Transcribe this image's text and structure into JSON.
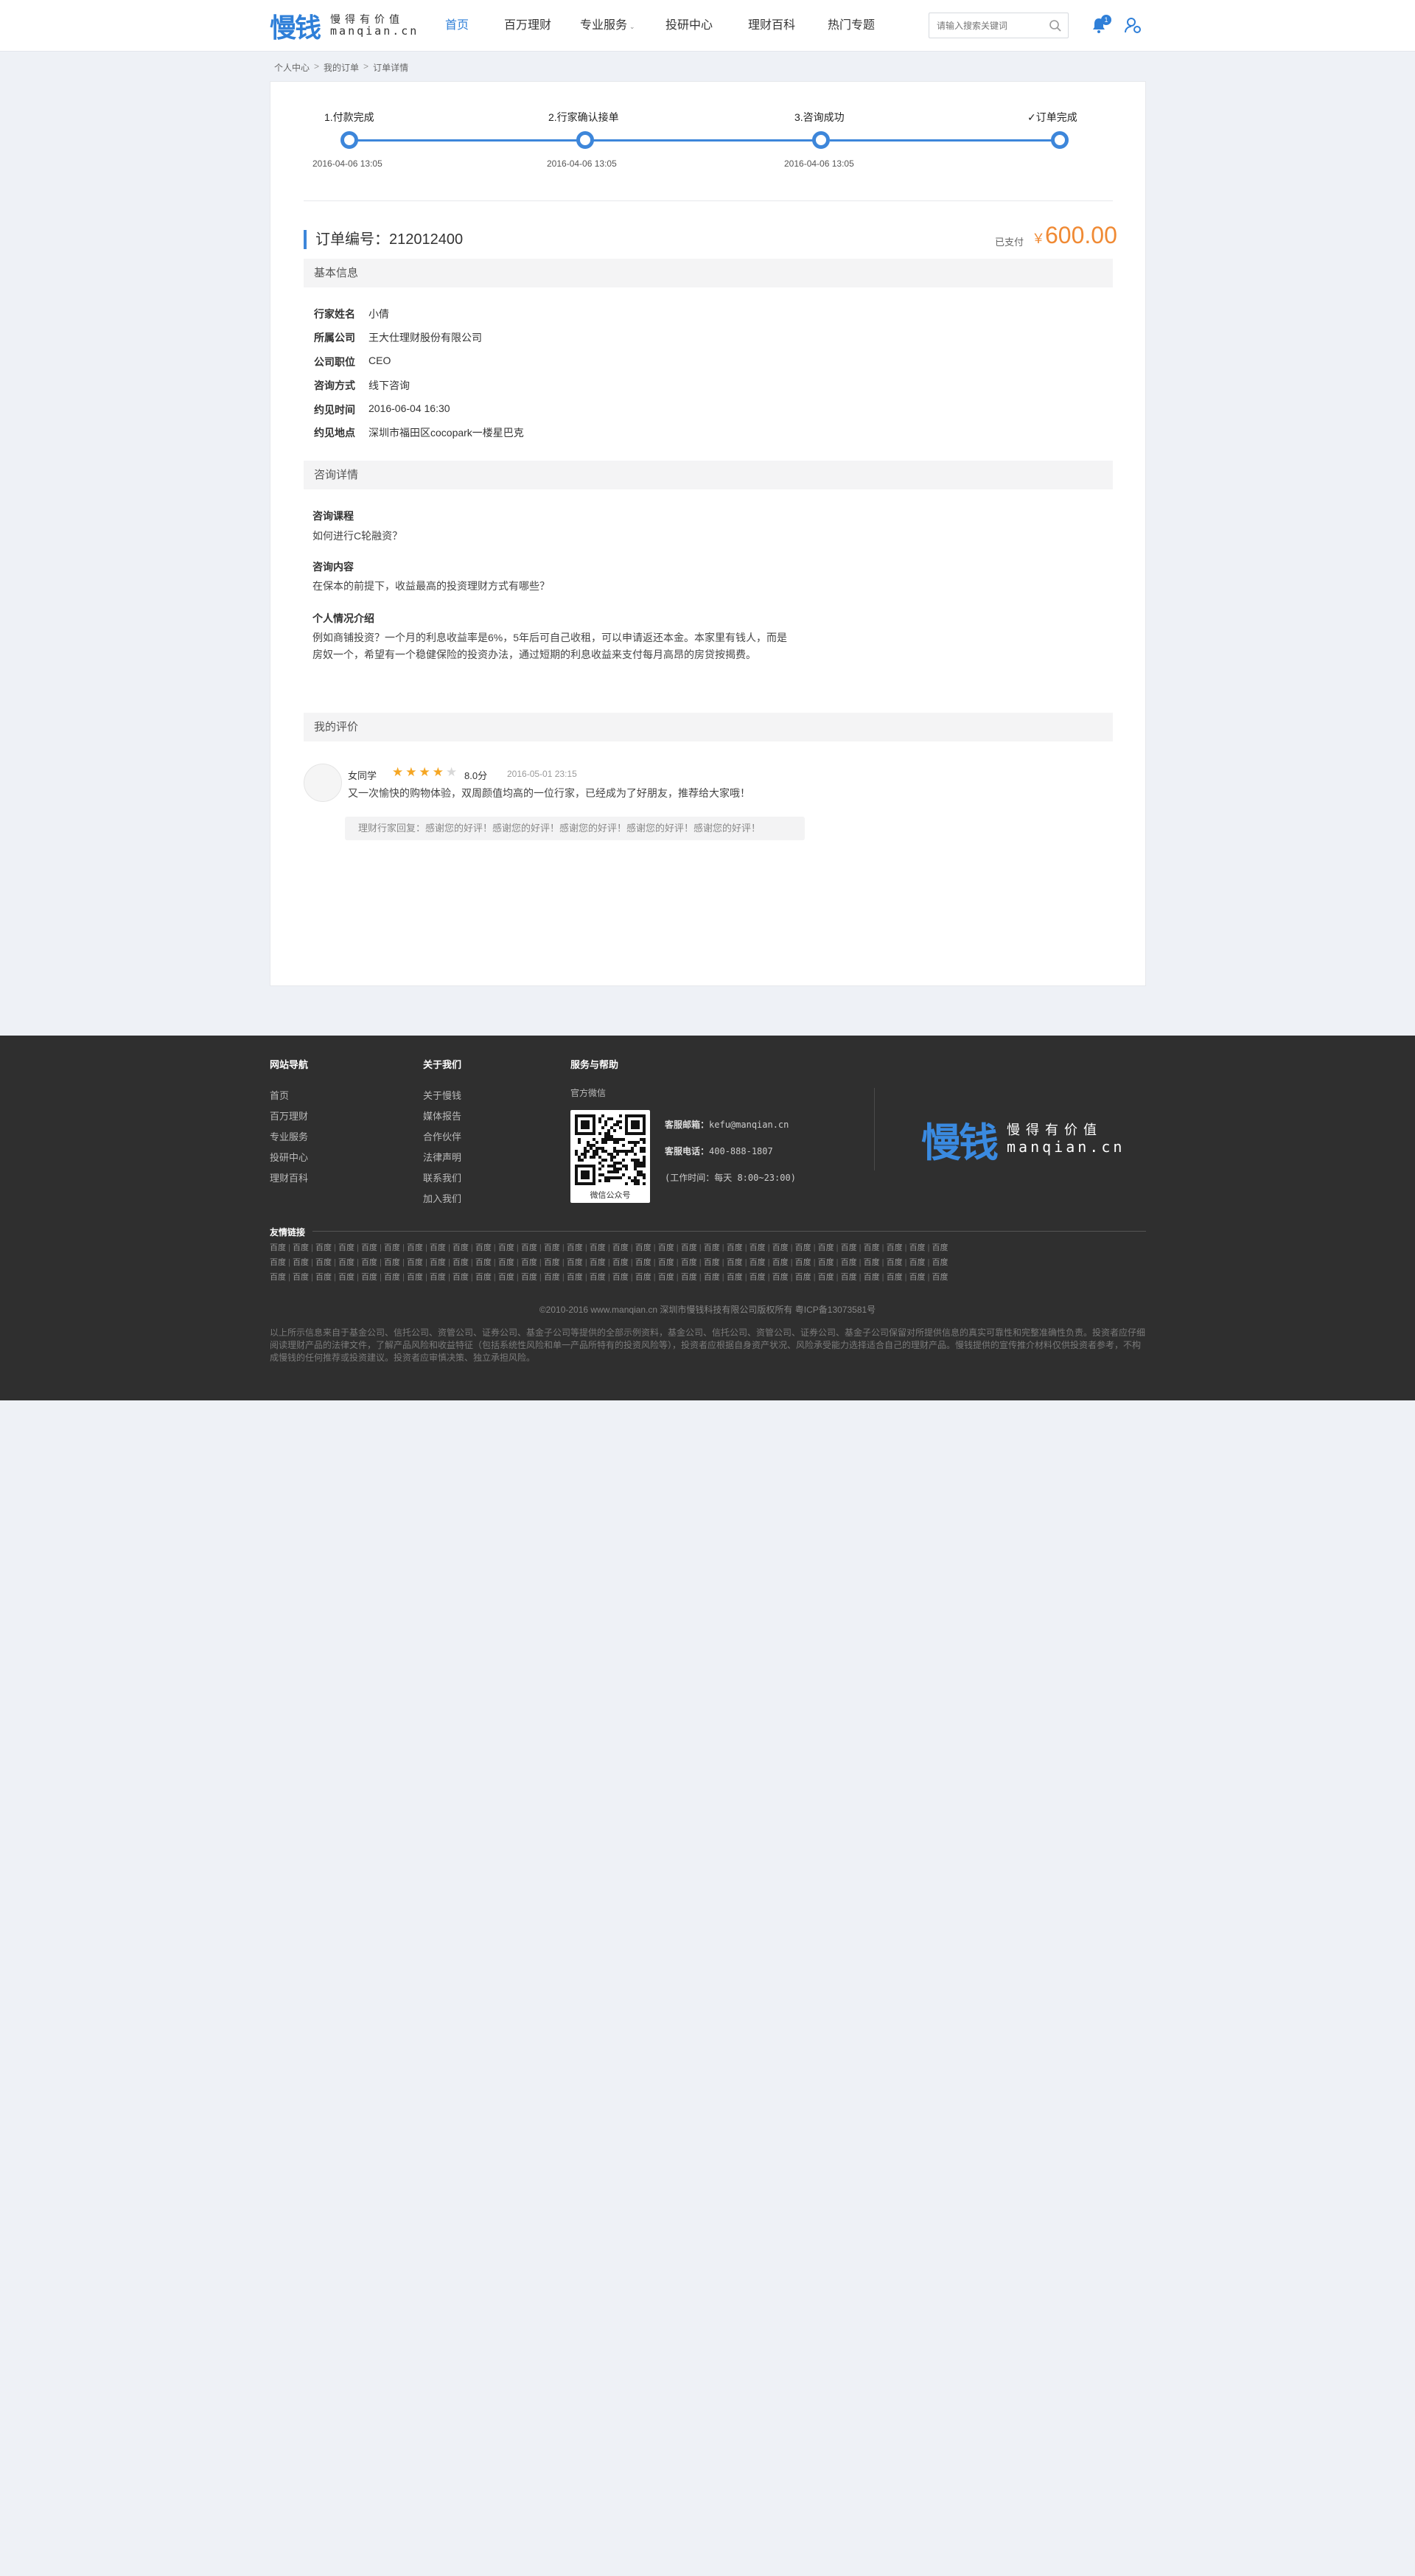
{
  "header": {
    "logo_cn": "慢钱",
    "logo_slogan": "慢得有价值",
    "logo_domain": "manqian.cn",
    "nav": [
      {
        "label": "首页",
        "active": true
      },
      {
        "label": "百万理财"
      },
      {
        "label": "专业服务",
        "has_dropdown": true,
        "dropdown_icon": "chevron-down-icon"
      },
      {
        "label": "投研中心"
      },
      {
        "label": "理财百科"
      },
      {
        "label": "热门专题"
      }
    ],
    "search_placeholder": "请输入搜索关键词",
    "notification_count": "1"
  },
  "breadcrumb": [
    "个人中心",
    "我的订单",
    "订单详情"
  ],
  "progress": {
    "steps": [
      {
        "label": "1.付款完成",
        "time": "2016-04-06 13:05"
      },
      {
        "label": "2.行家确认接单",
        "time": "2016-04-06 13:05"
      },
      {
        "label": "3.咨询成功",
        "time": "2016-04-06 13:05"
      },
      {
        "label": "订单完成",
        "time": ""
      }
    ]
  },
  "order": {
    "number_label": "订单编号：",
    "number": "212012400",
    "status": "已支付",
    "currency": "￥",
    "amount": "600.00"
  },
  "basic_info": {
    "title": "基本信息",
    "rows": [
      {
        "key": "行家姓名",
        "value": "小倩"
      },
      {
        "key": "所属公司",
        "value": "王大仕理财股份有限公司"
      },
      {
        "key": "公司职位",
        "value": "CEO"
      },
      {
        "key": "咨询方式",
        "value": "线下咨询"
      },
      {
        "key": "约见时间",
        "value": "2016-06-04 16:30"
      },
      {
        "key": "约见地点",
        "value": "深圳市福田区cocopark一楼星巴克"
      }
    ]
  },
  "consult_detail": {
    "title": "咨询详情",
    "course_title": "咨询课程",
    "course": "如何进行C轮融资？",
    "content_title": "咨询内容",
    "content": "在保本的前提下，收益最高的投资理财方式有哪些？",
    "intro_title": "个人情况介绍",
    "intro_line1": "例如商铺投资？一个月的利息收益率是6%，5年后可自己收租，可以申请返还本金。本家里有钱人，而是",
    "intro_line2": "房奴一个，希望有一个稳健保险的投资办法，通过短期的利息收益来支付每月高昂的房贷按揭费。"
  },
  "review": {
    "title": "我的评价",
    "reviewer": "女同学",
    "rating": 4,
    "rating_max": 5,
    "score": "8.0分",
    "date": "2016-05-01 23:15",
    "text": "又一次愉快的购物体验，双周颜值均高的一位行家，已经成为了好朋友，推荐给大家哦！",
    "reply": "理财行家回复：感谢您的好评！感谢您的好评！感谢您的好评！感谢您的好评！感谢您的好评！",
    "star_color": "#f5a623",
    "star_empty_color": "#d8d8d8"
  },
  "footer": {
    "nav_title": "网站导航",
    "nav_links": [
      "首页",
      "百万理财",
      "专业服务",
      "投研中心",
      "理财百科"
    ],
    "about_title": "关于我们",
    "about_links": [
      "关于慢钱",
      "媒体报告",
      "合作伙伴",
      "法律声明",
      "联系我们",
      "加入我们"
    ],
    "service_title": "服务与帮助",
    "wechat_label": "官方微信",
    "qr_caption": "微信公众号",
    "email_label": "客服邮箱：",
    "email": "kefu@manqian.cn",
    "phone_label": "客服电话：",
    "phone": "400-888-1807",
    "hours": "(工作时间：每天 8:00~23:00)",
    "friend_title": "友情链接",
    "friend_link_text": "百度",
    "copyright": "©2010-2016 www.manqian.cn 深圳市慢钱科技有限公司版权所有   粤ICP备13073581号",
    "disclaimer": "以上所示信息来自于基金公司、信托公司、资管公司、证券公司、基金子公司等提供的全部示例资料，基金公司、信托公司、资管公司、证券公司、基金子公司保留对所提供信息的真实可靠性和完整准确性负责。投资者应仔细阅读理财产品的法律文件，了解产品风险和收益特征（包括系统性风险和单一产品所特有的投资风险等），投资者应根据自身资产状况、风险承受能力选择适合自己的理财产品。慢钱提供的宣传推介材料仅供投资者参考，不构成慢钱的任何推荐或投资建议。投资者应审慎决策、独立承担风险。"
  },
  "colors": {
    "accent": "#3d86da",
    "price": "#f08a34",
    "footer_bg": "#2f2f2f",
    "page_bg": "#eef1f6"
  }
}
